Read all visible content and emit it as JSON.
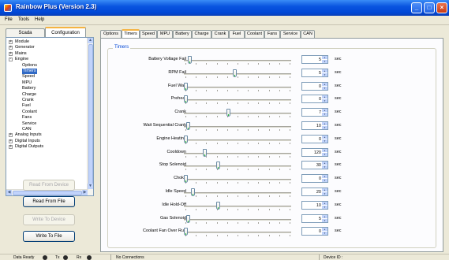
{
  "window": {
    "title": "Rainbow Plus (Version 2.3)",
    "min_glyph": "_",
    "max_glyph": "□",
    "close_glyph": "×"
  },
  "menu": {
    "file": "File",
    "tools": "Tools",
    "help": "Help"
  },
  "left_tabs": {
    "scada": "Scada",
    "configuration": "Configuration"
  },
  "tree": [
    {
      "label": "Module",
      "level": 0,
      "expander": "+"
    },
    {
      "label": "Generator",
      "level": 0,
      "expander": "+"
    },
    {
      "label": "Mains",
      "level": 0,
      "expander": "+"
    },
    {
      "label": "Engine",
      "level": 0,
      "expander": "-"
    },
    {
      "label": "Options",
      "level": 1
    },
    {
      "label": "Timers",
      "level": 1,
      "selected": true
    },
    {
      "label": "Speed",
      "level": 1
    },
    {
      "label": "MPU",
      "level": 1
    },
    {
      "label": "Battery",
      "level": 1
    },
    {
      "label": "Charge",
      "level": 1
    },
    {
      "label": "Crank",
      "level": 1
    },
    {
      "label": "Fuel",
      "level": 1
    },
    {
      "label": "Coolant",
      "level": 1
    },
    {
      "label": "Fans",
      "level": 1
    },
    {
      "label": "Service",
      "level": 1
    },
    {
      "label": "CAN",
      "level": 1
    },
    {
      "label": "Analog Inputs",
      "level": 0,
      "expander": "+"
    },
    {
      "label": "Digital Inputs",
      "level": 0,
      "expander": "+"
    },
    {
      "label": "Digital Outputs",
      "level": 0,
      "expander": "+"
    }
  ],
  "buttons": {
    "read_from_device": "Read From Device",
    "read_from_file": "Read From File",
    "write_to_device": "Write To Device",
    "write_to_file": "Write To File"
  },
  "right_tabs": [
    "Options",
    "Timers",
    "Speed",
    "MPU",
    "Battery",
    "Charge",
    "Crank",
    "Fuel",
    "Coolant",
    "Fans",
    "Service",
    "CAN"
  ],
  "active_tab": "Timers",
  "timers": {
    "legend": "Timers",
    "unit": "sec",
    "rows": [
      {
        "label": "Battery Voltage Fail",
        "value": "5",
        "slider": 0.04
      },
      {
        "label": "RPM Fail",
        "value": "5",
        "slider": 0.47
      },
      {
        "label": "Fuel Wait",
        "value": "0",
        "slider": 0.0
      },
      {
        "label": "Preheat",
        "value": "0",
        "slider": 0.0
      },
      {
        "label": "Crank",
        "value": "7",
        "slider": 0.41
      },
      {
        "label": "Wait Sequential Crank",
        "value": "10",
        "slider": 0.02
      },
      {
        "label": "Engine Heating",
        "value": "0",
        "slider": 0.0
      },
      {
        "label": "Cooldown",
        "value": "120",
        "slider": 0.18
      },
      {
        "label": "Stop Solenoid",
        "value": "30",
        "slider": 0.31
      },
      {
        "label": "Choke",
        "value": "0",
        "slider": 0.0
      },
      {
        "label": "Idle Speed",
        "value": "20",
        "slider": 0.07
      },
      {
        "label": "Idle Hold-Off",
        "value": "10",
        "slider": 0.31
      },
      {
        "label": "Gas Solenoid",
        "value": "5",
        "slider": 0.02
      },
      {
        "label": "Coolant Fan Over Run",
        "value": "0",
        "slider": 0.0
      }
    ]
  },
  "status": {
    "data_ready": "Data Ready",
    "tx": "Tx",
    "rx": "Rx",
    "connection": "No Connections",
    "device_id": "Device ID :"
  },
  "colors": {
    "titlebar": "#0047d6",
    "selection": "#316ac5",
    "legend": "#0046d5",
    "thumb_accent": "#22c03a"
  }
}
